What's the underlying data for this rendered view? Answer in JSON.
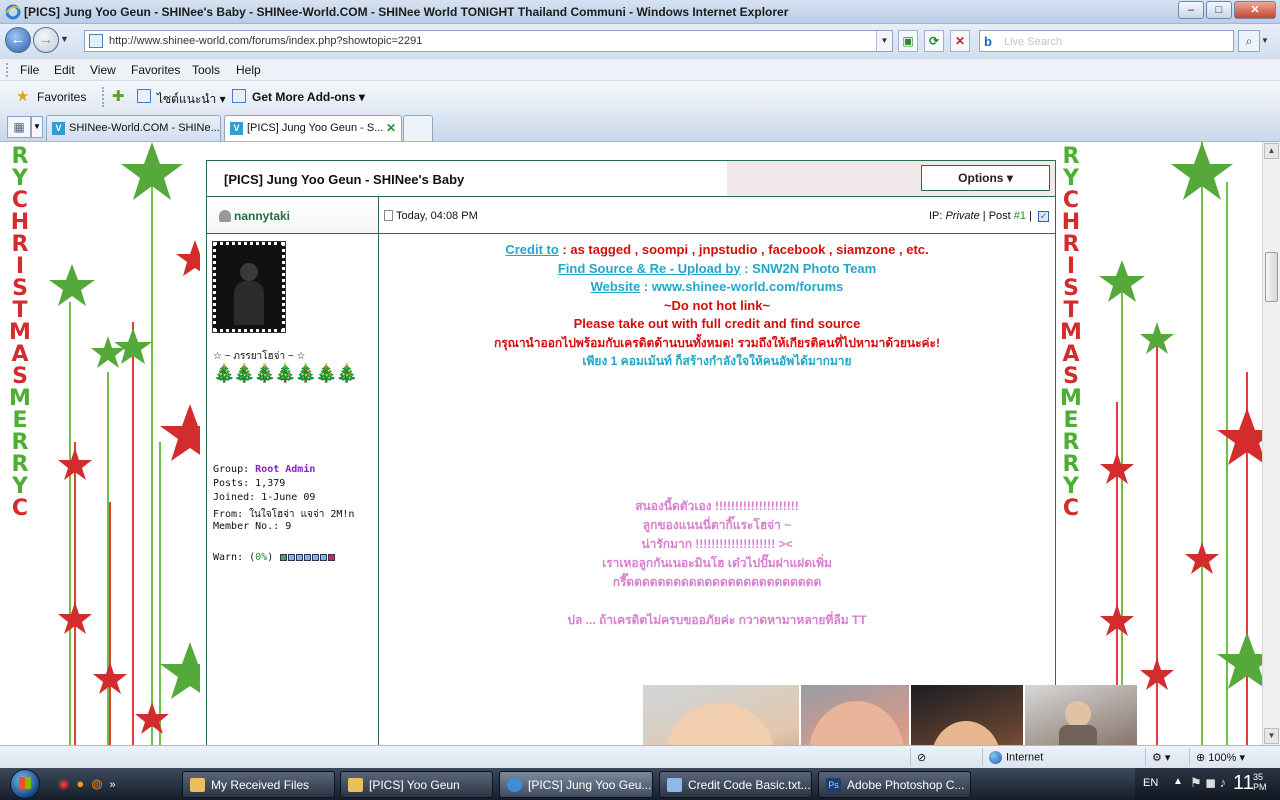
{
  "window": {
    "title": "[PICS] Jung Yoo Geun - SHINee's Baby - SHINee-World.COM - SHINee World TONIGHT Thailand Communi - Windows Internet Explorer",
    "min_label": "–",
    "max_label": "□",
    "close_label": "✕"
  },
  "address_bar": {
    "url": "http://www.shinee-world.com/forums/index.php?showtopic=2291",
    "search_placeholder": "Live Search"
  },
  "menu": [
    "File",
    "Edit",
    "View",
    "Favorites",
    "Tools",
    "Help"
  ],
  "favorites_bar": {
    "favorites_label": "Favorites",
    "suggested_sites": "ไซต์แนะนำ ▾",
    "addons": "Get More Add-ons ▾"
  },
  "tabs": [
    {
      "label": "SHINee-World.COM - SHINe...",
      "active": false
    },
    {
      "label": "[PICS] Jung Yoo Geun - S...",
      "active": true
    }
  ],
  "decor": {
    "left_letters": [
      "R",
      "Y",
      "C",
      "H",
      "R",
      "I",
      "S",
      "T",
      "M",
      "A",
      "S",
      "M",
      "E",
      "R",
      "R",
      "Y",
      "C"
    ],
    "right_letters": [
      "R",
      "Y",
      "C",
      "H",
      "R",
      "I",
      "S",
      "T",
      "M",
      "A",
      "S",
      "M",
      "E",
      "R",
      "R",
      "Y",
      "C"
    ]
  },
  "post": {
    "title": "[PICS] Jung Yoo Geun - SHINee's Baby",
    "options_label": "Options ▾",
    "author": {
      "name": "nannytaki",
      "user_title": "☆ ~ ภรรยาโฮจ่า ~ ☆",
      "trees": "🎄🎄🎄🎄🎄🎄🎄",
      "group_label": "Group:",
      "group_value": "Root Admin",
      "posts_label": "Posts:",
      "posts_value": "1,379",
      "joined_label": "Joined:",
      "joined_value": "1-June 09",
      "from_label": "From:",
      "from_value": "ในใจโฮจ่า แจจ่า 2M!n",
      "member_label": "Member No.:",
      "member_value": "9",
      "warn_label": "Warn: (",
      "warn_value": "0%",
      "warn_close": ")"
    },
    "meta": {
      "date": "Today, 04:08 PM",
      "ip_label": "IP: ",
      "ip_value": "Private",
      "post_label": " | Post ",
      "post_num": "#1",
      "sep": " |"
    },
    "body": {
      "credit_link": "Credit to",
      "credit_rest": " : as tagged , soompi , jnpstudio , facebook , siamzone , etc.",
      "find_link": "Find Source & Re - Upload by",
      "find_rest": " : SNW2N Photo Team",
      "website_link": "Website",
      "website_rest": " : www.shinee-world.com/forums",
      "no_hotlink": "~Do not hot link~",
      "take_out": "Please take out with full credit and find source",
      "thai_line1": "กรุณานำออกไปพร้อมกับเครดิตด้านบนทั้งหมด! รวมถึงให้เกียรติคนที่ไปหามาด้วยนะค่ะ!",
      "thai_line2": "เพียง 1 คอมเม้นท์ ก็สร้างกำลังใจให้คนอัพได้มากมาย",
      "pink_lines": [
        "สนองนี้ดตัวเอง !!!!!!!!!!!!!!!!!!!!!",
        "ลูกของแนนนี่ตากิ๊แระโฮจ่า ~",
        "น่ารักมาก !!!!!!!!!!!!!!!!!!!! ><",
        "เราเหอลูกกันเนอะมินโฮ เด๋วไปปั๊มฝาแฝดเพิ่ม",
        "กรี๊ดดดดดดดดดดดดดดดดดดดดดดดดด",
        "",
        "ปล ... ถ้าเครดิตไม่ครบขออภัยค่ะ กวาดหามาหลายที่ลืม TT"
      ]
    }
  },
  "status_bar": {
    "zone": "Internet",
    "zoom": "100%"
  },
  "taskbar": {
    "items": [
      {
        "label": "My Received Files",
        "color": "#e9c15a"
      },
      {
        "label": "[PICS] Yoo Geun",
        "color": "#e9c15a"
      },
      {
        "label": "[PICS] Jung Yoo Geu...",
        "color": "#3a8fd8"
      },
      {
        "label": "Credit Code Basic.txt...",
        "color": "#8fb8e8"
      },
      {
        "label": "Adobe Photoshop C...",
        "color": "#1b3d73"
      }
    ],
    "lang": "EN",
    "time_big": "11",
    "time_small_1": "35",
    "time_small_2": "PM"
  },
  "colors": {
    "accent_green": "#2c6b4b",
    "cyan": "#23a6c9",
    "red": "#d60d0d",
    "pink": "#d97fcf",
    "group_purple": "#8a1fc7"
  }
}
